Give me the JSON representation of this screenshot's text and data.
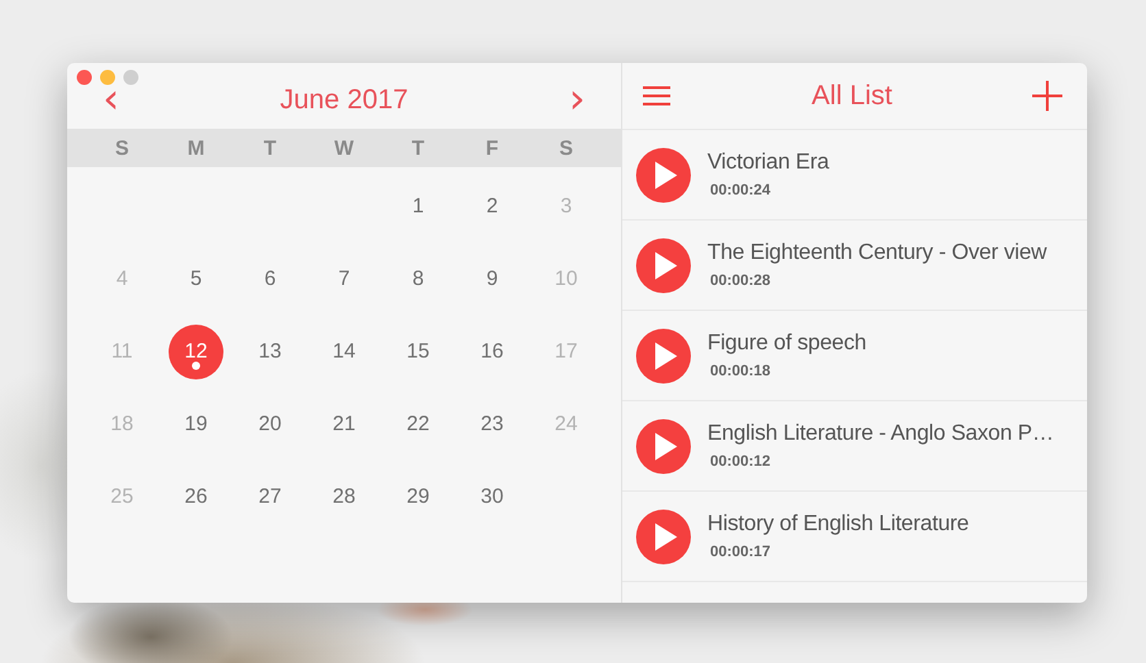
{
  "calendar": {
    "prev": "‹",
    "title": "June 2017",
    "next": "›",
    "weekdays": [
      "S",
      "M",
      "T",
      "W",
      "T",
      "F",
      "S"
    ],
    "weeks": [
      [
        {
          "kind": "blank"
        },
        {
          "kind": "blank"
        },
        {
          "kind": "blank"
        },
        {
          "kind": "blank"
        },
        {
          "kind": "day",
          "label": "1",
          "muted": false,
          "selected": false,
          "has_event": false
        },
        {
          "kind": "day",
          "label": "2",
          "muted": false,
          "selected": false,
          "has_event": false
        },
        {
          "kind": "day",
          "label": "3",
          "muted": true,
          "selected": false,
          "has_event": false
        }
      ],
      [
        {
          "kind": "day",
          "label": "4",
          "muted": true,
          "selected": false,
          "has_event": false
        },
        {
          "kind": "day",
          "label": "5",
          "muted": false,
          "selected": false,
          "has_event": false
        },
        {
          "kind": "day",
          "label": "6",
          "muted": false,
          "selected": false,
          "has_event": false
        },
        {
          "kind": "day",
          "label": "7",
          "muted": false,
          "selected": false,
          "has_event": false
        },
        {
          "kind": "day",
          "label": "8",
          "muted": false,
          "selected": false,
          "has_event": false
        },
        {
          "kind": "day",
          "label": "9",
          "muted": false,
          "selected": false,
          "has_event": false
        },
        {
          "kind": "day",
          "label": "10",
          "muted": true,
          "selected": false,
          "has_event": false
        }
      ],
      [
        {
          "kind": "day",
          "label": "11",
          "muted": true,
          "selected": false,
          "has_event": false
        },
        {
          "kind": "day",
          "label": "12",
          "muted": false,
          "selected": true,
          "has_event": true
        },
        {
          "kind": "day",
          "label": "13",
          "muted": false,
          "selected": false,
          "has_event": false
        },
        {
          "kind": "day",
          "label": "14",
          "muted": false,
          "selected": false,
          "has_event": false
        },
        {
          "kind": "day",
          "label": "15",
          "muted": false,
          "selected": false,
          "has_event": false
        },
        {
          "kind": "day",
          "label": "16",
          "muted": false,
          "selected": false,
          "has_event": false
        },
        {
          "kind": "day",
          "label": "17",
          "muted": true,
          "selected": false,
          "has_event": false
        }
      ],
      [
        {
          "kind": "day",
          "label": "18",
          "muted": true,
          "selected": false,
          "has_event": false
        },
        {
          "kind": "day",
          "label": "19",
          "muted": false,
          "selected": false,
          "has_event": false
        },
        {
          "kind": "day",
          "label": "20",
          "muted": false,
          "selected": false,
          "has_event": false
        },
        {
          "kind": "day",
          "label": "21",
          "muted": false,
          "selected": false,
          "has_event": false
        },
        {
          "kind": "day",
          "label": "22",
          "muted": false,
          "selected": false,
          "has_event": false
        },
        {
          "kind": "day",
          "label": "23",
          "muted": false,
          "selected": false,
          "has_event": false
        },
        {
          "kind": "day",
          "label": "24",
          "muted": true,
          "selected": false,
          "has_event": false
        }
      ],
      [
        {
          "kind": "day",
          "label": "25",
          "muted": true,
          "selected": false,
          "has_event": false
        },
        {
          "kind": "day",
          "label": "26",
          "muted": false,
          "selected": false,
          "has_event": false
        },
        {
          "kind": "day",
          "label": "27",
          "muted": false,
          "selected": false,
          "has_event": false
        },
        {
          "kind": "day",
          "label": "28",
          "muted": false,
          "selected": false,
          "has_event": false
        },
        {
          "kind": "day",
          "label": "29",
          "muted": false,
          "selected": false,
          "has_event": false
        },
        {
          "kind": "day",
          "label": "30",
          "muted": false,
          "selected": false,
          "has_event": false
        },
        {
          "kind": "blank"
        }
      ]
    ]
  },
  "list": {
    "title": "All List",
    "items": [
      {
        "title": "Victorian Era",
        "duration": "00:00:24"
      },
      {
        "title": "The Eighteenth Century - Over view",
        "duration": "00:00:28"
      },
      {
        "title": "Figure of speech",
        "duration": "00:00:18"
      },
      {
        "title": "English Literature - Anglo Saxon P…",
        "duration": "00:00:12"
      },
      {
        "title": "History of English Literature",
        "duration": "00:00:17"
      }
    ]
  }
}
